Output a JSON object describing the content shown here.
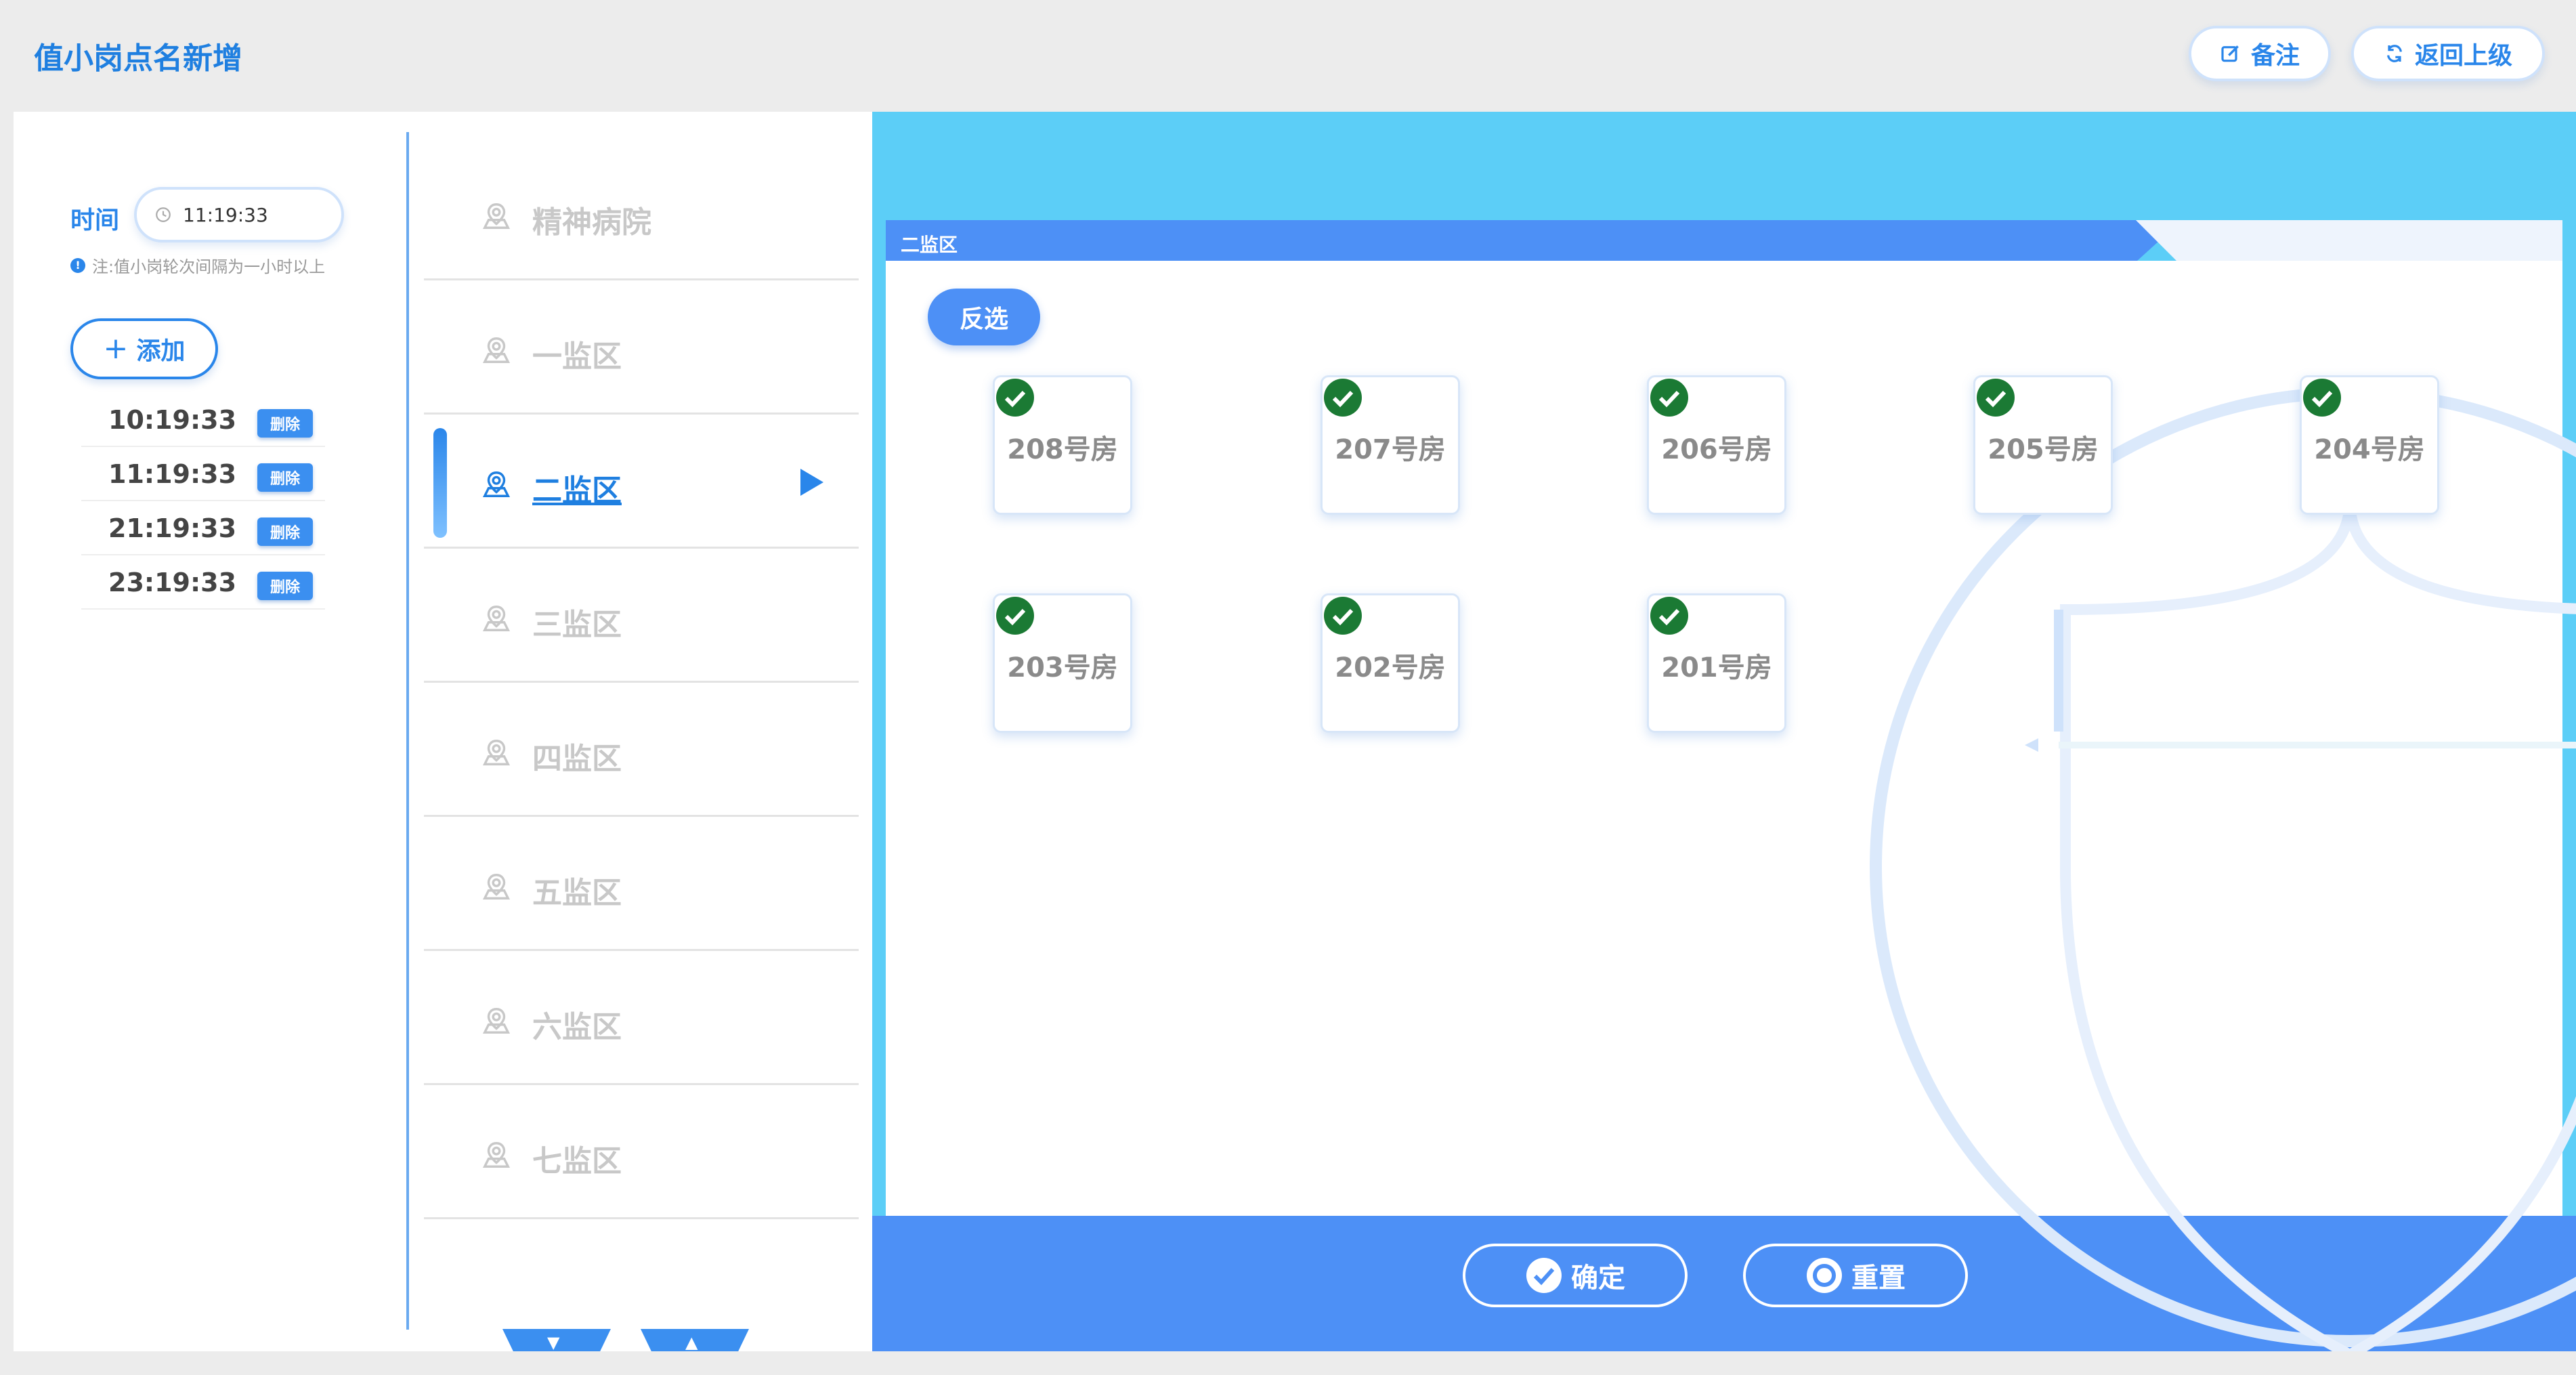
{
  "header": {
    "title": "值小岗点名新增",
    "note_button": "备注",
    "back_button": "返回上级"
  },
  "left": {
    "time_label": "时间",
    "time_value": "11:19:33",
    "note": "注:值小岗轮次间隔为一小时以上",
    "add_button": "添加",
    "times": [
      {
        "time": "10:19:33",
        "delete": "删除"
      },
      {
        "time": "11:19:33",
        "delete": "删除"
      },
      {
        "time": "21:19:33",
        "delete": "删除"
      },
      {
        "time": "23:19:33",
        "delete": "删除"
      }
    ]
  },
  "areas": [
    {
      "label": "精神病院",
      "active": false
    },
    {
      "label": "一监区",
      "active": false
    },
    {
      "label": "二监区",
      "active": true
    },
    {
      "label": "三监区",
      "active": false
    },
    {
      "label": "四监区",
      "active": false
    },
    {
      "label": "五监区",
      "active": false
    },
    {
      "label": "六监区",
      "active": false
    },
    {
      "label": "七监区",
      "active": false
    }
  ],
  "zone": {
    "title": "二监区",
    "invert_button": "反选",
    "rooms": [
      {
        "label": "208号房",
        "checked": true
      },
      {
        "label": "207号房",
        "checked": true
      },
      {
        "label": "206号房",
        "checked": true
      },
      {
        "label": "205号房",
        "checked": true
      },
      {
        "label": "204号房",
        "checked": true
      },
      {
        "label": "203号房",
        "checked": true
      },
      {
        "label": "202号房",
        "checked": true
      },
      {
        "label": "201号房",
        "checked": true
      }
    ]
  },
  "footer": {
    "confirm": "确定",
    "reset": "重置"
  },
  "colors": {
    "accent": "#2a86ea",
    "panel_blue": "#5ccef7",
    "bar_blue": "#4d90f6",
    "check_green": "#1b7a34"
  }
}
